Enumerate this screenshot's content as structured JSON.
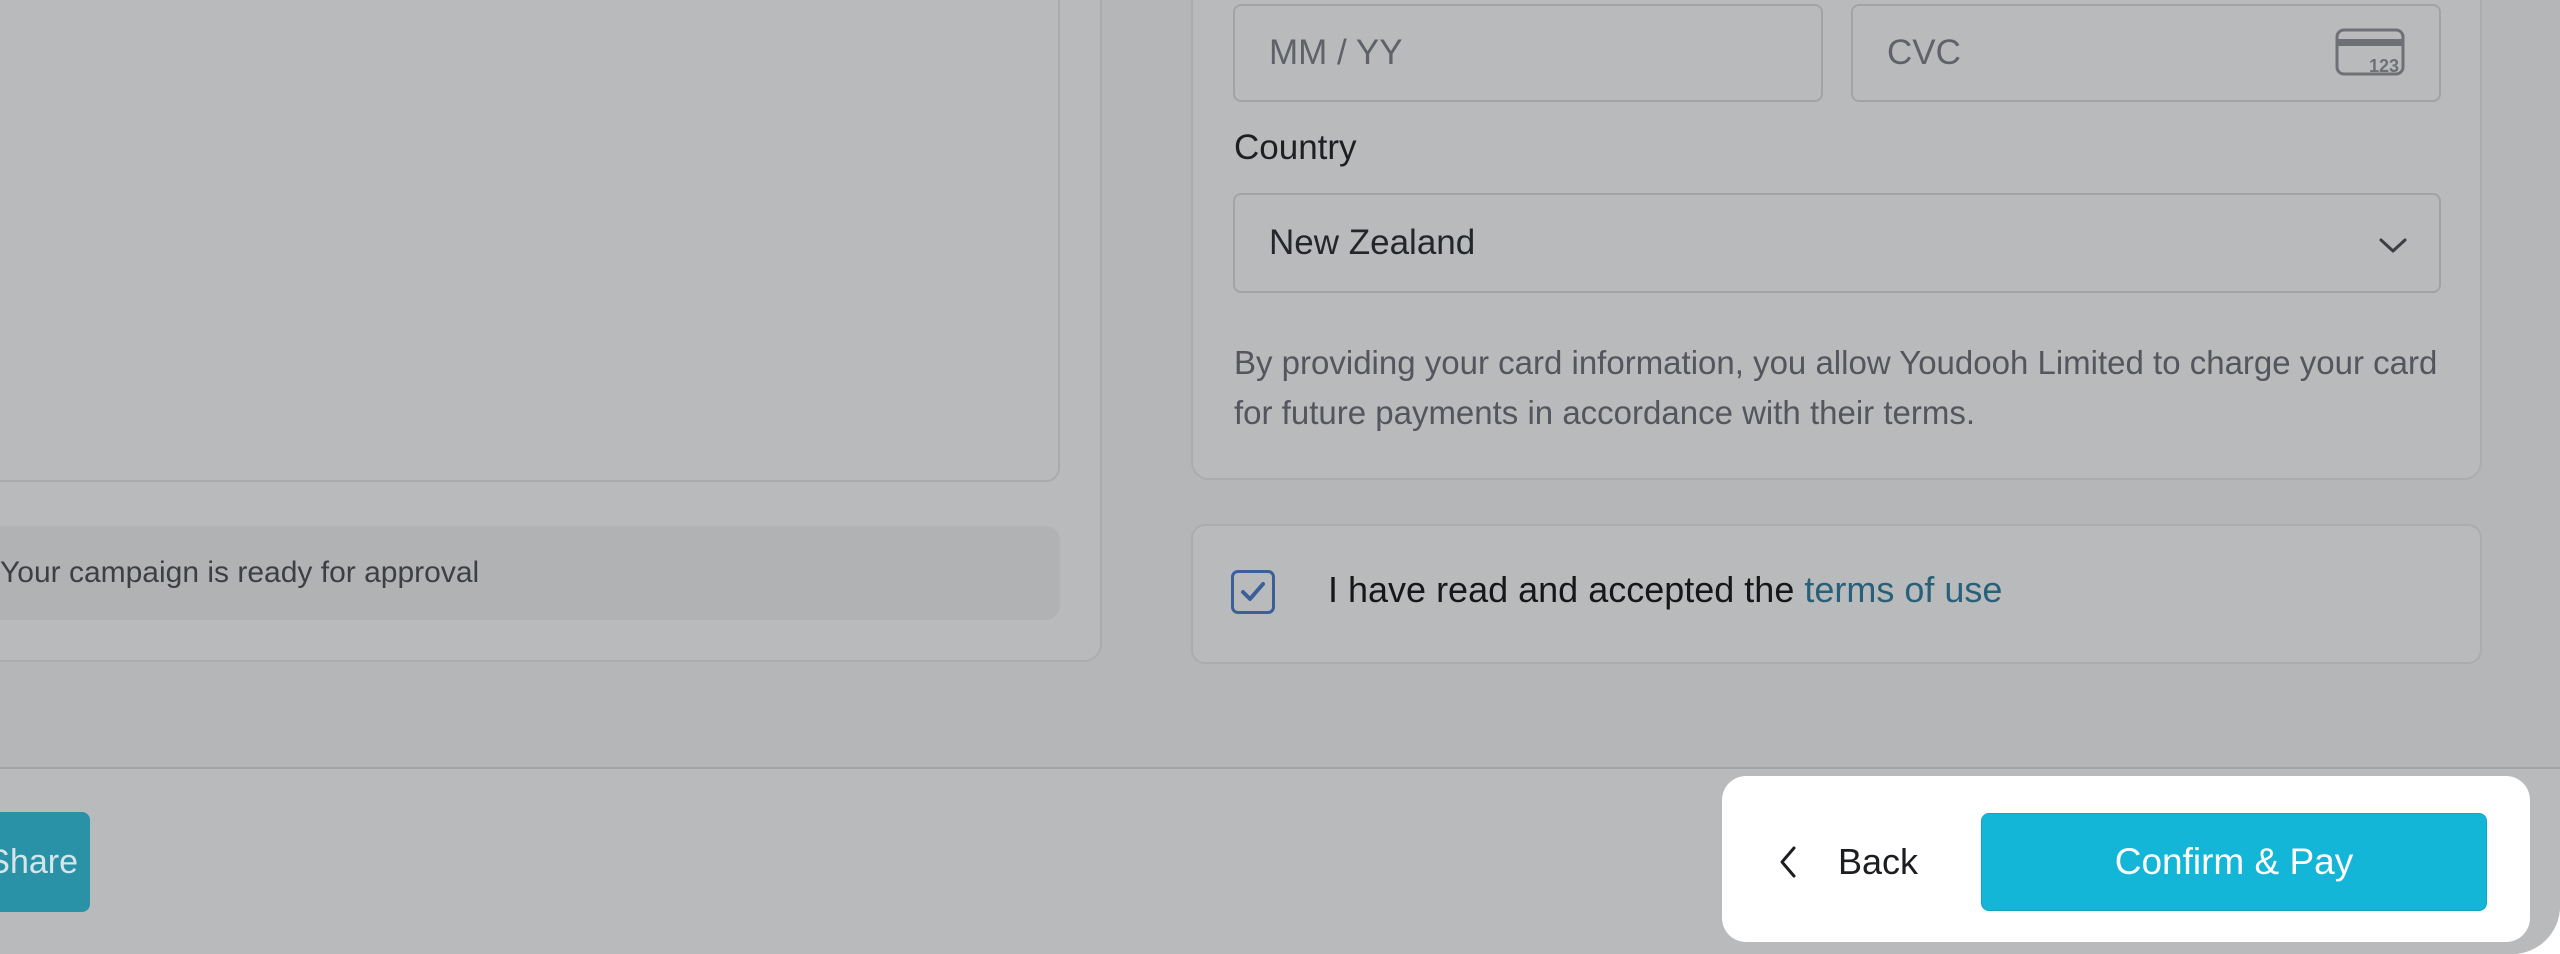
{
  "payment": {
    "expiry_placeholder": "MM / YY",
    "cvc_placeholder": "CVC",
    "country_label": "Country",
    "country_value": "New Zealand",
    "disclaimer": "By providing your card information, you allow Youdooh Limited to charge your card for future payments in accordance with their terms."
  },
  "campaign": {
    "status_text": "Your campaign is ready for approval"
  },
  "terms": {
    "checked": true,
    "text": "I have read and accepted the ",
    "link": "terms of use"
  },
  "footer": {
    "share_label": "Share",
    "back_label": "Back",
    "confirm_label": "Confirm & Pay"
  },
  "colors": {
    "primary_button": "#14b6d8",
    "checkbox_border": "#3d5f99",
    "link": "#28607a"
  }
}
